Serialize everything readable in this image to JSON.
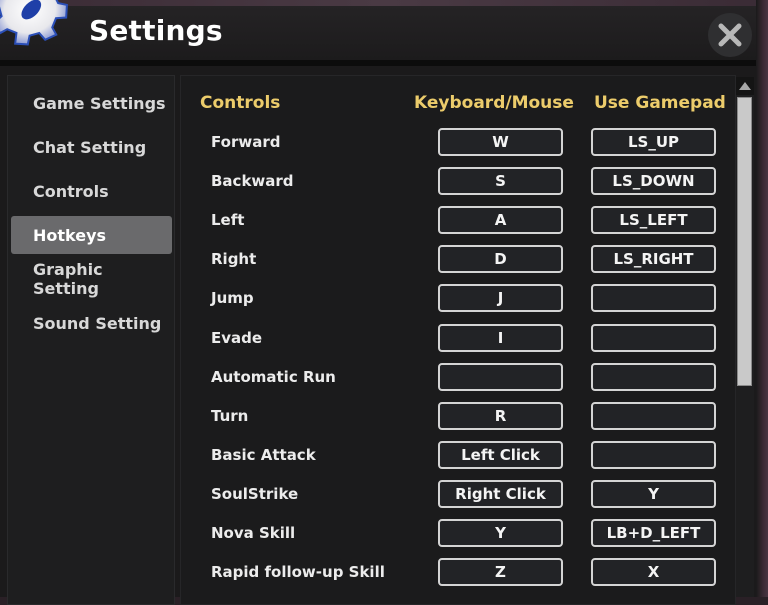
{
  "window": {
    "title": "Settings",
    "icon": "gear-icon",
    "close_icon": "close-icon"
  },
  "sidebar": {
    "items": [
      {
        "label": "Game Settings",
        "active": false
      },
      {
        "label": "Chat Setting",
        "active": false
      },
      {
        "label": "Controls",
        "active": false
      },
      {
        "label": "Hotkeys",
        "active": true
      },
      {
        "label": "Graphic Setting",
        "active": false
      },
      {
        "label": "Sound Setting",
        "active": false
      }
    ]
  },
  "main": {
    "headers": {
      "controls": "Controls",
      "keyboard": "Keyboard/Mouse",
      "gamepad": "Use Gamepad"
    },
    "rows": [
      {
        "action": "Forward",
        "keyboard": "W",
        "gamepad": "LS_UP"
      },
      {
        "action": "Backward",
        "keyboard": "S",
        "gamepad": "LS_DOWN"
      },
      {
        "action": "Left",
        "keyboard": "A",
        "gamepad": "LS_LEFT"
      },
      {
        "action": "Right",
        "keyboard": "D",
        "gamepad": "LS_RIGHT"
      },
      {
        "action": "Jump",
        "keyboard": "J",
        "gamepad": ""
      },
      {
        "action": "Evade",
        "keyboard": "I",
        "gamepad": ""
      },
      {
        "action": "Automatic Run",
        "keyboard": "",
        "gamepad": ""
      },
      {
        "action": "Turn",
        "keyboard": "R",
        "gamepad": ""
      },
      {
        "action": "Basic Attack",
        "keyboard": "Left Click",
        "gamepad": ""
      },
      {
        "action": "SoulStrike",
        "keyboard": "Right Click",
        "gamepad": "Y"
      },
      {
        "action": "Nova Skill",
        "keyboard": "Y",
        "gamepad": "LB+D_LEFT"
      },
      {
        "action": "Rapid follow-up Skill",
        "keyboard": "Z",
        "gamepad": "X"
      }
    ]
  },
  "colors": {
    "header_text": "#eccc6b",
    "active_tab": "#6a6a6c",
    "panel_bg": "#1b1b1c"
  }
}
